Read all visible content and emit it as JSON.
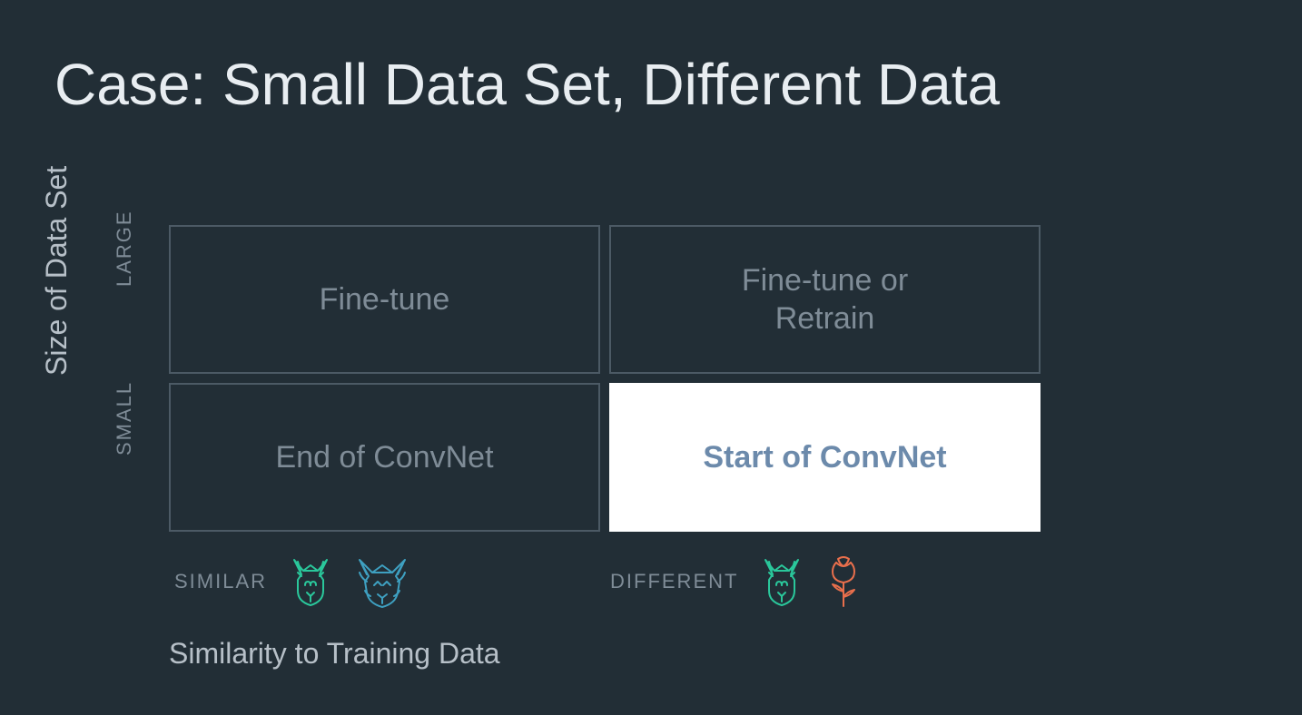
{
  "title": "Case: Small Data Set, Different Data",
  "y_axis_label": "Size of Data Set",
  "y_ticks": {
    "large": "LARGE",
    "small": "SMALL"
  },
  "x_axis_label": "Similarity to Training Data",
  "x_ticks": {
    "similar": "SIMILAR",
    "different": "DIFFERENT"
  },
  "cells": {
    "large_similar": "Fine-tune",
    "large_different": "Fine-tune or\nRetrain",
    "small_similar": "End of ConvNet",
    "small_different": "Start of ConvNet"
  },
  "active_cell": "small_different",
  "icons": {
    "similar": [
      "dog-icon",
      "wolf-icon"
    ],
    "different": [
      "dog-icon",
      "rose-icon"
    ]
  },
  "colors": {
    "bg": "#222e36",
    "title_text": "#e8edf1",
    "muted_text": "#7f8c97",
    "axis_text": "#b7c0c8",
    "cell_border": "#4c5a65",
    "active_bg": "#ffffff",
    "active_text": "#6c8aab",
    "dog_color": "#2ac79b",
    "wolf_color": "#3ea0c1",
    "rose_color": "#e96f4c"
  },
  "chart_data": {
    "type": "table",
    "title": "Transfer-learning strategy by data-set size vs. similarity to training data",
    "rows": [
      "LARGE",
      "SMALL"
    ],
    "columns": [
      "SIMILAR",
      "DIFFERENT"
    ],
    "row_axis": "Size of Data Set",
    "column_axis": "Similarity to Training Data",
    "values": [
      [
        "Fine-tune",
        "Fine-tune or Retrain"
      ],
      [
        "End of ConvNet",
        "Start of ConvNet"
      ]
    ],
    "highlighted": {
      "row": "SMALL",
      "column": "DIFFERENT"
    }
  }
}
